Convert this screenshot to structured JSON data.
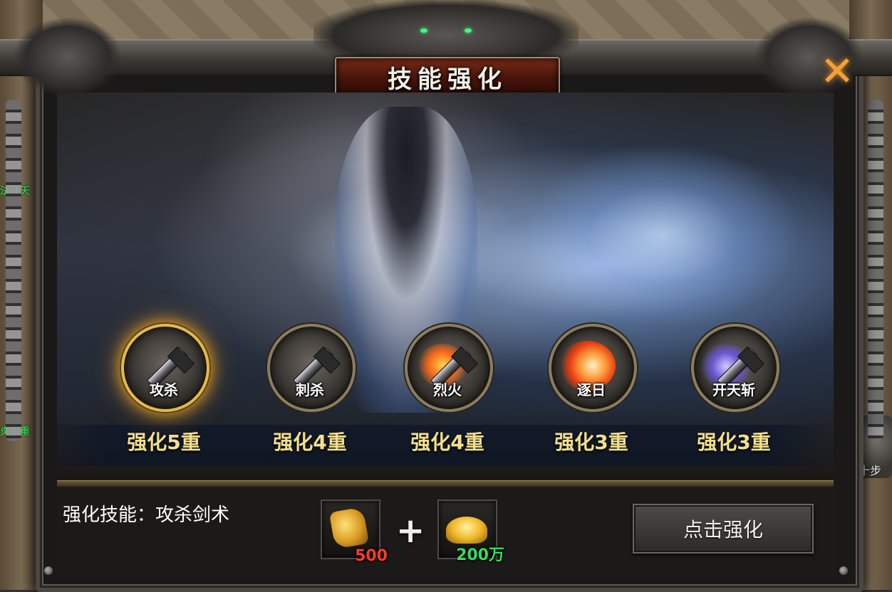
{
  "dialog": {
    "title": "技能强化",
    "close_symbol": "✕"
  },
  "side_labels": {
    "left_top": "法飞天",
    "left_bottom": "炎山重",
    "right_badge": "十步"
  },
  "skills": [
    {
      "name": "攻杀",
      "level_label": "强化5重",
      "icon": "sword-skill-icon",
      "selected": true
    },
    {
      "name": "刺杀",
      "level_label": "强化4重",
      "icon": "sword-skill-icon",
      "selected": false
    },
    {
      "name": "烈火",
      "level_label": "强化4重",
      "icon": "fire-sword-icon",
      "selected": false
    },
    {
      "name": "逐日",
      "level_label": "强化3重",
      "icon": "sun-slash-icon",
      "selected": false
    },
    {
      "name": "开天斩",
      "level_label": "强化3重",
      "icon": "purple-slash-icon",
      "selected": false
    }
  ],
  "bottom": {
    "enhance_target": "强化技能：攻杀剑术",
    "cost_items": [
      {
        "icon": "scroll-icon",
        "count": "500"
      },
      {
        "icon": "gold-ingot-icon",
        "count": "200万"
      }
    ],
    "plus": "+",
    "enhance_button": "点击强化"
  },
  "colors": {
    "selected_glow": "#f7a924",
    "level_text": "#f4e08a",
    "count_red": "#ff3a2a",
    "count_green": "#33e05a"
  }
}
